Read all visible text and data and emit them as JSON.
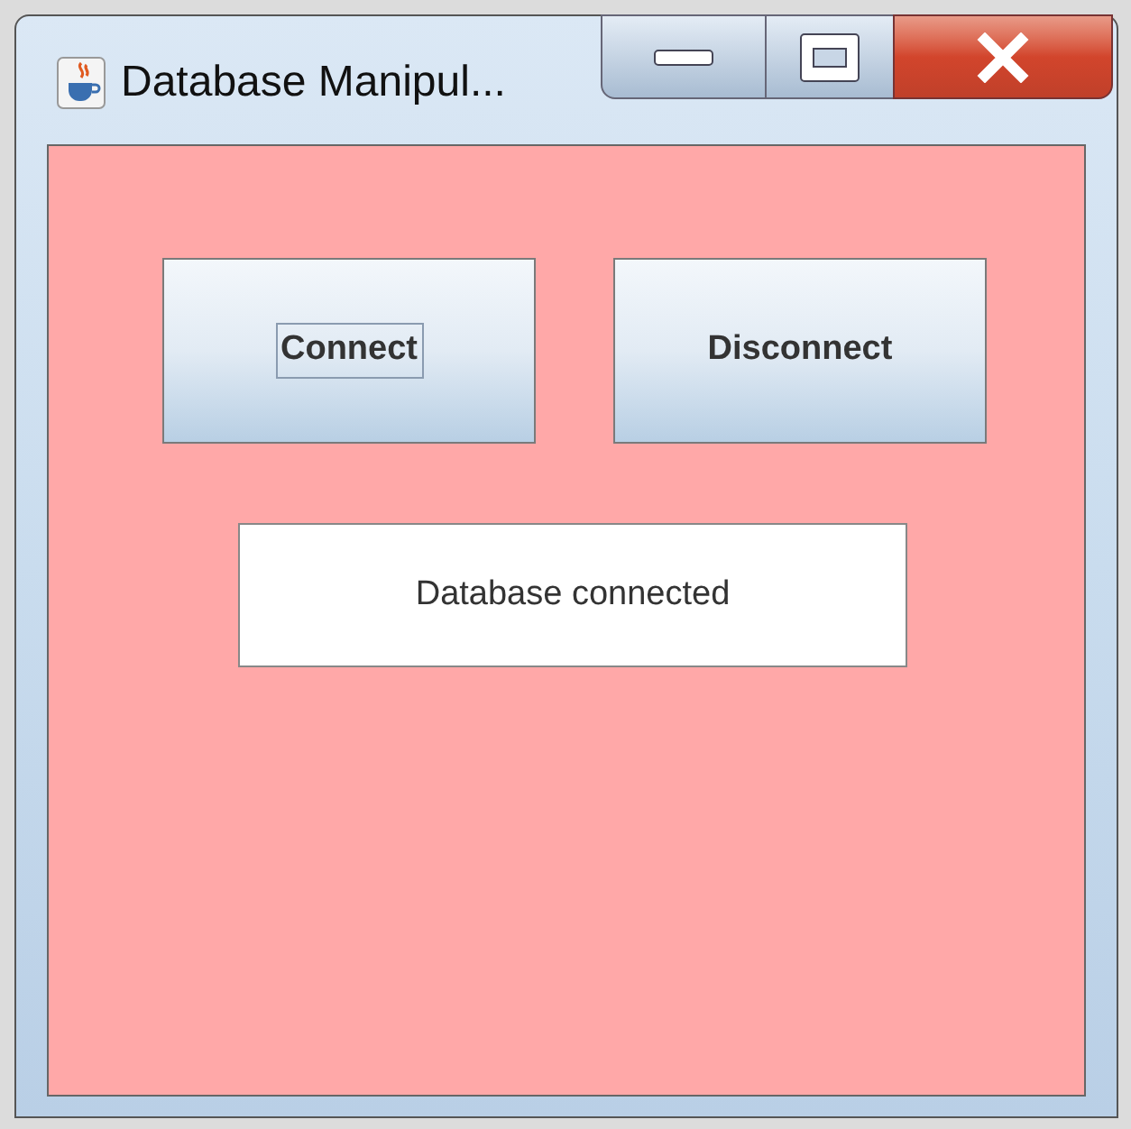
{
  "window": {
    "title": "Database Manipul..."
  },
  "buttons": [
    {
      "label": "Connect",
      "focused": true
    },
    {
      "label": "Disconnect",
      "focused": false
    }
  ],
  "status": {
    "value": "Database connected"
  }
}
